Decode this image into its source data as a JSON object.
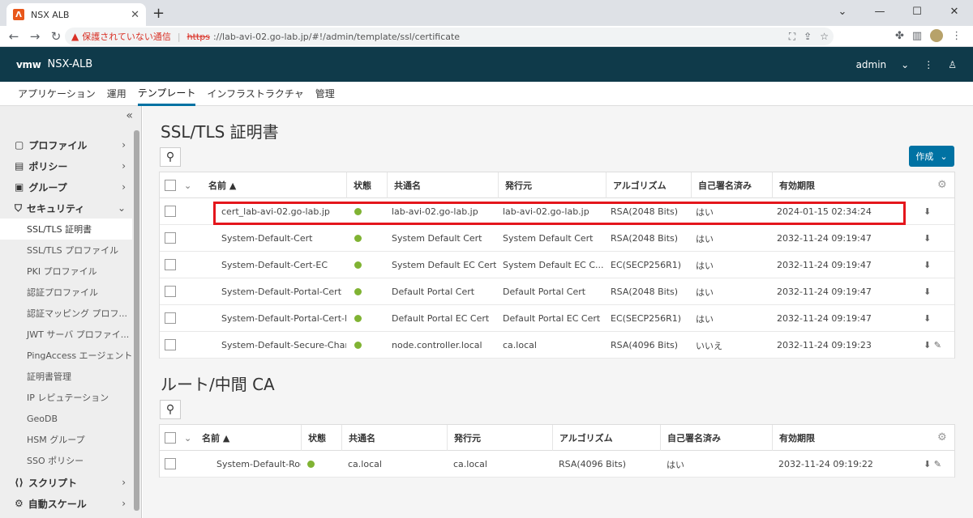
{
  "browser": {
    "tab_title": "NSX ALB",
    "tab_favicon": "Λ",
    "close": "✕",
    "new_tab": "+",
    "win": [
      "⌄",
      "—",
      "☐",
      "✕"
    ],
    "insecure_label": "保護されていない通信",
    "url_scheme": "https",
    "url_rest": "://lab-avi-02.go-lab.jp/#!/admin/template/ssl/certificate",
    "nav": {
      "back": "←",
      "forward": "→",
      "reload": "↻"
    }
  },
  "header": {
    "logo": "vmw",
    "title": "NSX-ALB",
    "user": "admin",
    "user_chevron": "⌄",
    "more": "⋮",
    "person": "♙"
  },
  "nav_tabs": [
    "アプリケーション",
    "運用",
    "テンプレート",
    "インフラストラクチャ",
    "管理"
  ],
  "sidebar": {
    "collapse": "«",
    "groups": [
      {
        "label": "プロファイル",
        "icon": "▢",
        "chev": "›"
      },
      {
        "label": "ポリシー",
        "icon": "▤",
        "chev": "›"
      },
      {
        "label": "グループ",
        "icon": "▣",
        "chev": "›"
      },
      {
        "label": "セキュリティ",
        "icon": "⛉",
        "chev": "⌄"
      }
    ],
    "items": [
      "SSL/TLS 証明書",
      "SSL/TLS プロファイル",
      "PKI プロファイル",
      "認証プロファイル",
      "認証マッピング プロフ...",
      "JWT サーバ プロファイ...",
      "PingAccess エージェント",
      "証明書管理",
      "IP レピュテーション",
      "GeoDB",
      "HSM グループ",
      "SSO ポリシー"
    ],
    "bottom_groups": [
      {
        "label": "スクリプト",
        "icon": "⟨⟩",
        "chev": "›"
      },
      {
        "label": "自動スケール",
        "icon": "⚙",
        "chev": "›"
      }
    ]
  },
  "ssl": {
    "title": "SSL/TLS 証明書",
    "search_icon": "⚲",
    "create_label": "作成",
    "create_chevron": "⌄",
    "headers": [
      "名前 ▲",
      "状態",
      "共通名",
      "発行元",
      "アルゴリズム",
      "自己署名済み",
      "有効期限"
    ],
    "rows": [
      {
        "name": "cert_lab-avi-02.go-lab.jp",
        "cn": "lab-avi-02.go-lab.jp",
        "issuer": "lab-avi-02.go-lab.jp",
        "alg": "RSA(2048 Bits)",
        "self": "はい",
        "exp": "2024-01-15 02:34:24",
        "actions": "⬇"
      },
      {
        "name": "System-Default-Cert",
        "cn": "System Default Cert",
        "issuer": "System Default Cert",
        "alg": "RSA(2048 Bits)",
        "self": "はい",
        "exp": "2032-11-24 09:19:47",
        "actions": "⬇"
      },
      {
        "name": "System-Default-Cert-EC",
        "cn": "System Default EC Cert",
        "issuer": "System Default EC C...",
        "alg": "EC(SECP256R1)",
        "self": "はい",
        "exp": "2032-11-24 09:19:47",
        "actions": "⬇"
      },
      {
        "name": "System-Default-Portal-Cert",
        "cn": "Default Portal Cert",
        "issuer": "Default Portal Cert",
        "alg": "RSA(2048 Bits)",
        "self": "はい",
        "exp": "2032-11-24 09:19:47",
        "actions": "⬇"
      },
      {
        "name": "System-Default-Portal-Cert-EC",
        "cn": "Default Portal EC Cert",
        "issuer": "Default Portal EC Cert",
        "alg": "EC(SECP256R1)",
        "self": "はい",
        "exp": "2032-11-24 09:19:47",
        "actions": "⬇"
      },
      {
        "name": "System-Default-Secure-Channel",
        "cn": "node.controller.local",
        "issuer": "ca.local",
        "alg": "RSA(4096 Bits)",
        "self": "いいえ",
        "exp": "2032-11-24 09:19:23",
        "actions": "⬇ ✎"
      }
    ]
  },
  "ca": {
    "title": "ルート/中間 CA",
    "search_icon": "⚲",
    "headers": [
      "名前 ▲",
      "状態",
      "共通名",
      "発行元",
      "アルゴリズム",
      "自己署名済み",
      "有効期限"
    ],
    "rows": [
      {
        "name": "System-Default-Root",
        "cn": "ca.local",
        "issuer": "ca.local",
        "alg": "RSA(4096 Bits)",
        "self": "はい",
        "exp": "2032-11-24 09:19:22",
        "actions": "⬇ ✎"
      }
    ]
  },
  "colors": {
    "header_bg": "#0f3a4a",
    "primary": "#0072a3",
    "status_ok": "#80b333",
    "highlight": "#e4161c"
  }
}
